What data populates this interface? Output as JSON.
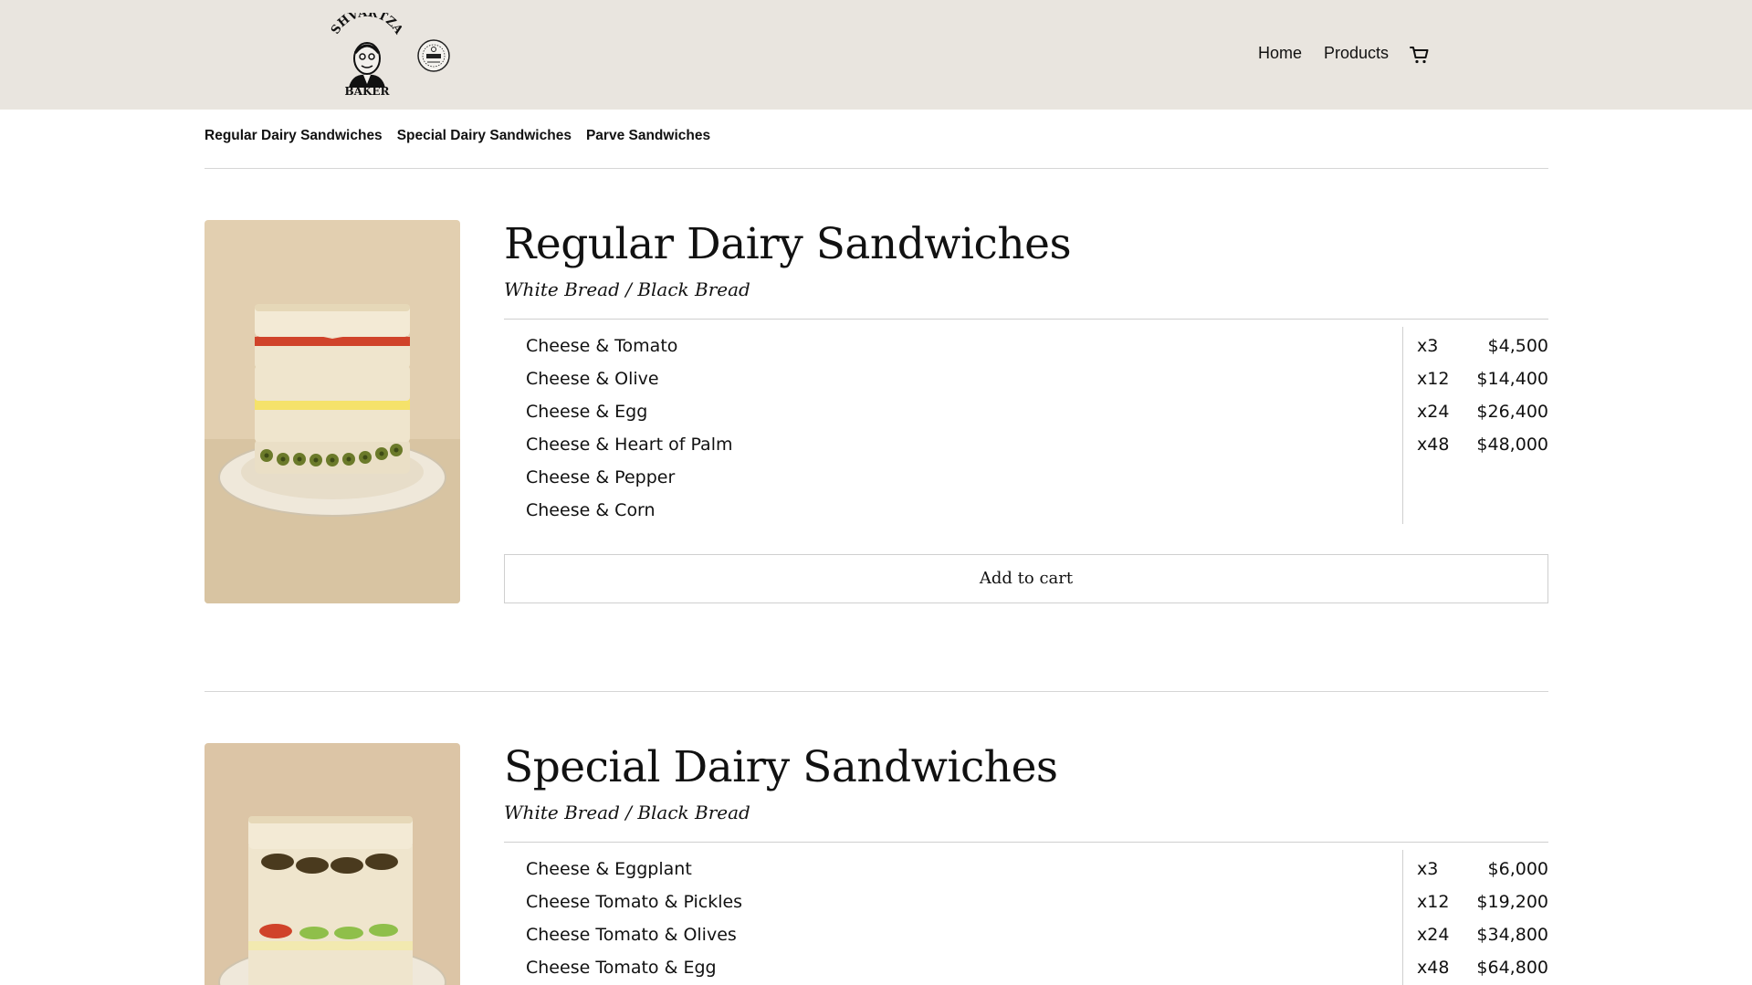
{
  "header": {
    "logo_text_top": "SHVARTZA",
    "logo_text_bottom": "BAKER",
    "nav": {
      "home": "Home",
      "products": "Products"
    }
  },
  "tabs": [
    "Regular Dairy Sandwiches",
    "Special Dairy Sandwiches",
    "Parve Sandwiches"
  ],
  "products": [
    {
      "title": "Regular Dairy Sandwiches",
      "subtitle": "White Bread / Black Bread",
      "items": [
        "Cheese & Tomato",
        "Cheese & Olive",
        "Cheese & Egg",
        "Cheese & Heart of Palm",
        "Cheese & Pepper",
        "Cheese & Corn"
      ],
      "prices": [
        {
          "qty": "x3",
          "price": "$4,500"
        },
        {
          "qty": "x12",
          "price": "$14,400"
        },
        {
          "qty": "x24",
          "price": "$26,400"
        },
        {
          "qty": "x48",
          "price": "$48,000"
        }
      ],
      "button": "Add to cart"
    },
    {
      "title": "Special Dairy Sandwiches",
      "subtitle": "White Bread / Black Bread",
      "items": [
        "Cheese & Eggplant",
        "Cheese Tomato & Pickles",
        "Cheese Tomato & Olives",
        "Cheese Tomato & Egg"
      ],
      "prices": [
        {
          "qty": "x3",
          "price": "$6,000"
        },
        {
          "qty": "x12",
          "price": "$19,200"
        },
        {
          "qty": "x24",
          "price": "$34,800"
        },
        {
          "qty": "x48",
          "price": "$64,800"
        }
      ]
    }
  ],
  "colors": {
    "header_bg": "#e9e5df",
    "photo_bg": "#e2cfb0",
    "rule": "#d6d6d6"
  },
  "icons": {
    "cart": "cart-icon",
    "logo": "baker-portrait-logo",
    "seal": "kosher-seal-icon"
  }
}
